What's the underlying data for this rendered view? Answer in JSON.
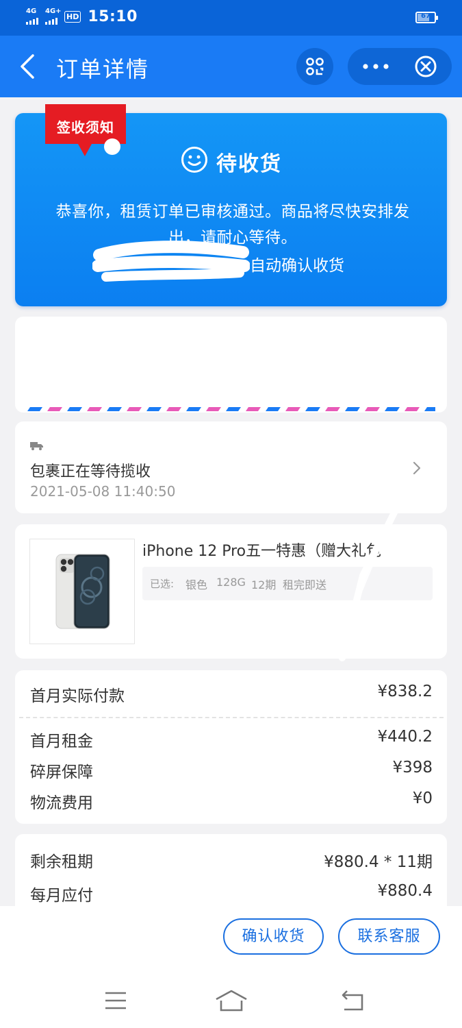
{
  "status_bar": {
    "signal1": "4G",
    "signal2": "4G+",
    "hd_badge": "HD",
    "time": "15:10",
    "battery": "67"
  },
  "nav": {
    "title": "订单详情",
    "back_icon": "chevron-left-icon",
    "scan_icon": "scan-icon",
    "more_icon": "more-dots-icon",
    "close_icon": "close-circle-icon"
  },
  "status_card": {
    "ribbon_label": "签收须知",
    "title": "待收货",
    "message": "恭喜你，租赁订单已审核通过。商品将尽快安排发出，请耐心等待。",
    "auto_confirm": "自动确认收货"
  },
  "logistics": {
    "status": "包裹正在等待揽收",
    "time": "2021-05-08 11:40:50"
  },
  "product": {
    "name": "iPhone 12 Pro五一特惠（赠大礼包",
    "spec_label": "已选:",
    "specs": [
      "银色",
      "128G",
      "12期",
      "租完即送"
    ]
  },
  "payment": {
    "first_month_label": "首月实际付款",
    "first_month_value": "¥838.2",
    "items": [
      {
        "label": "首月租金",
        "value": "¥440.2"
      },
      {
        "label": "碎屏保障",
        "value": "¥398"
      },
      {
        "label": "物流费用",
        "value": "¥0"
      }
    ]
  },
  "terms": {
    "remaining_label": "剩余租期",
    "remaining_value": "¥880.4 * 11期",
    "monthly_label": "每月应付",
    "monthly_value": "¥880.4"
  },
  "actions": {
    "confirm": "确认收货",
    "contact": "联系客服"
  },
  "colors": {
    "primary": "#1a7bf5",
    "status_bar": "#0a64d8",
    "ribbon": "#e51c23",
    "button_border": "#1a6fe0"
  }
}
